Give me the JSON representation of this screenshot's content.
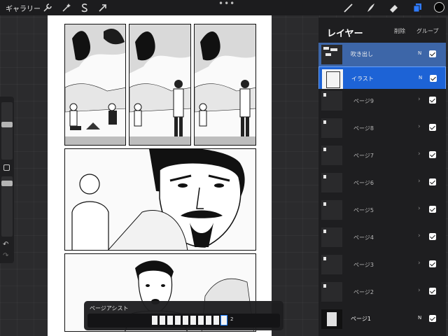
{
  "toolbar": {
    "gallery_label": "ギャラリー",
    "more_dots": "•••"
  },
  "icons": {
    "actions": "wrench-icon",
    "adjustments": "magic-wand-icon",
    "selection": "selection-s-icon",
    "transform": "arrow-cursor-icon",
    "brush": "brush-icon",
    "smudge": "smudge-icon",
    "eraser": "eraser-icon",
    "layers": "layers-icon",
    "color": "color-circle-icon"
  },
  "colors": {
    "active_tool": "#2f7bff",
    "selected_layer": "#1d63d6",
    "secondary_selected": "#3d66a8",
    "current_color": "#050505"
  },
  "sidebar": {
    "undo": "↶",
    "redo": "↷"
  },
  "page_assist": {
    "title": "ページアシスト",
    "pages_count_note": "2"
  },
  "layers": {
    "title": "レイヤー",
    "delete_label": "削除",
    "group_label": "グループ",
    "items": [
      {
        "name": "吹き出し",
        "blend": "N",
        "visible": true,
        "type": "layer",
        "state": "selected"
      },
      {
        "name": "イラスト",
        "blend": "N",
        "visible": true,
        "type": "layer",
        "state": "primary"
      },
      {
        "name": "ページ9",
        "visible": true,
        "type": "group"
      },
      {
        "name": "ページ8",
        "visible": true,
        "type": "group"
      },
      {
        "name": "ページ7",
        "visible": true,
        "type": "group"
      },
      {
        "name": "ページ6",
        "visible": true,
        "type": "group"
      },
      {
        "name": "ページ5",
        "visible": true,
        "type": "group"
      },
      {
        "name": "ページ4",
        "visible": true,
        "type": "group"
      },
      {
        "name": "ページ3",
        "visible": true,
        "type": "group"
      },
      {
        "name": "ページ2",
        "visible": true,
        "type": "group"
      },
      {
        "name": "ページ1",
        "blend": "N",
        "visible": true,
        "type": "layer"
      }
    ]
  }
}
